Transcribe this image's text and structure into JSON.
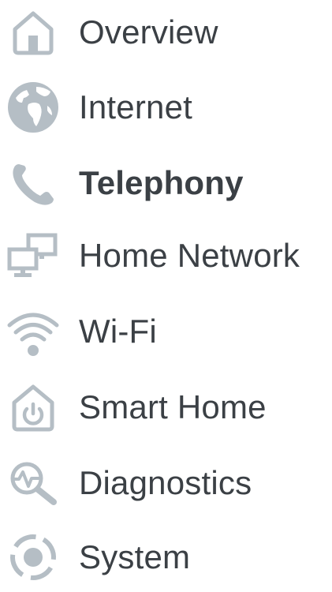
{
  "nav": {
    "active": "Telephony",
    "icon_color": "#b5bec5",
    "text_color": "#3b4045",
    "items": [
      {
        "label": "Overview",
        "icon": "home-icon"
      },
      {
        "label": "Internet",
        "icon": "globe-icon"
      },
      {
        "label": "Telephony",
        "icon": "phone-icon"
      },
      {
        "label": "Home Network",
        "icon": "network-icon"
      },
      {
        "label": "Wi-Fi",
        "icon": "wifi-icon"
      },
      {
        "label": "Smart Home",
        "icon": "smart-home-icon"
      },
      {
        "label": "Diagnostics",
        "icon": "diagnostics-icon"
      },
      {
        "label": "System",
        "icon": "system-icon"
      }
    ]
  }
}
